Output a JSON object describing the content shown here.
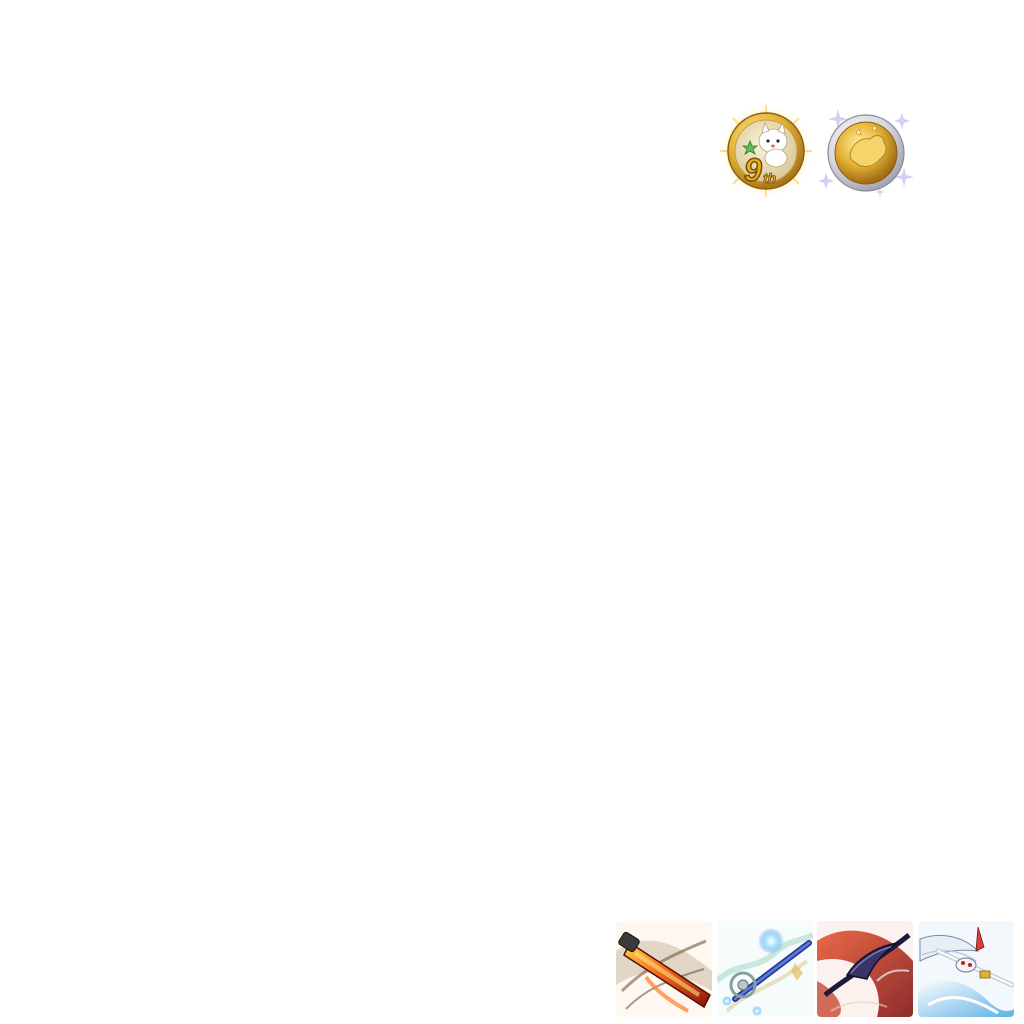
{
  "medals": [
    {
      "icon": "anniversary-9th-medal-icon",
      "label": "9",
      "suffix": "th"
    },
    {
      "icon": "silver-gold-medal-icon"
    }
  ],
  "weapons": [
    {
      "icon": "flame-greatsword-icon",
      "accent": "#e8401c"
    },
    {
      "icon": "crystal-staff-icon",
      "accent": "#3a6ee0"
    },
    {
      "icon": "dark-scythe-icon",
      "accent": "#b0201c"
    },
    {
      "icon": "white-winged-blade-icon",
      "accent": "#5cb8e8"
    }
  ]
}
